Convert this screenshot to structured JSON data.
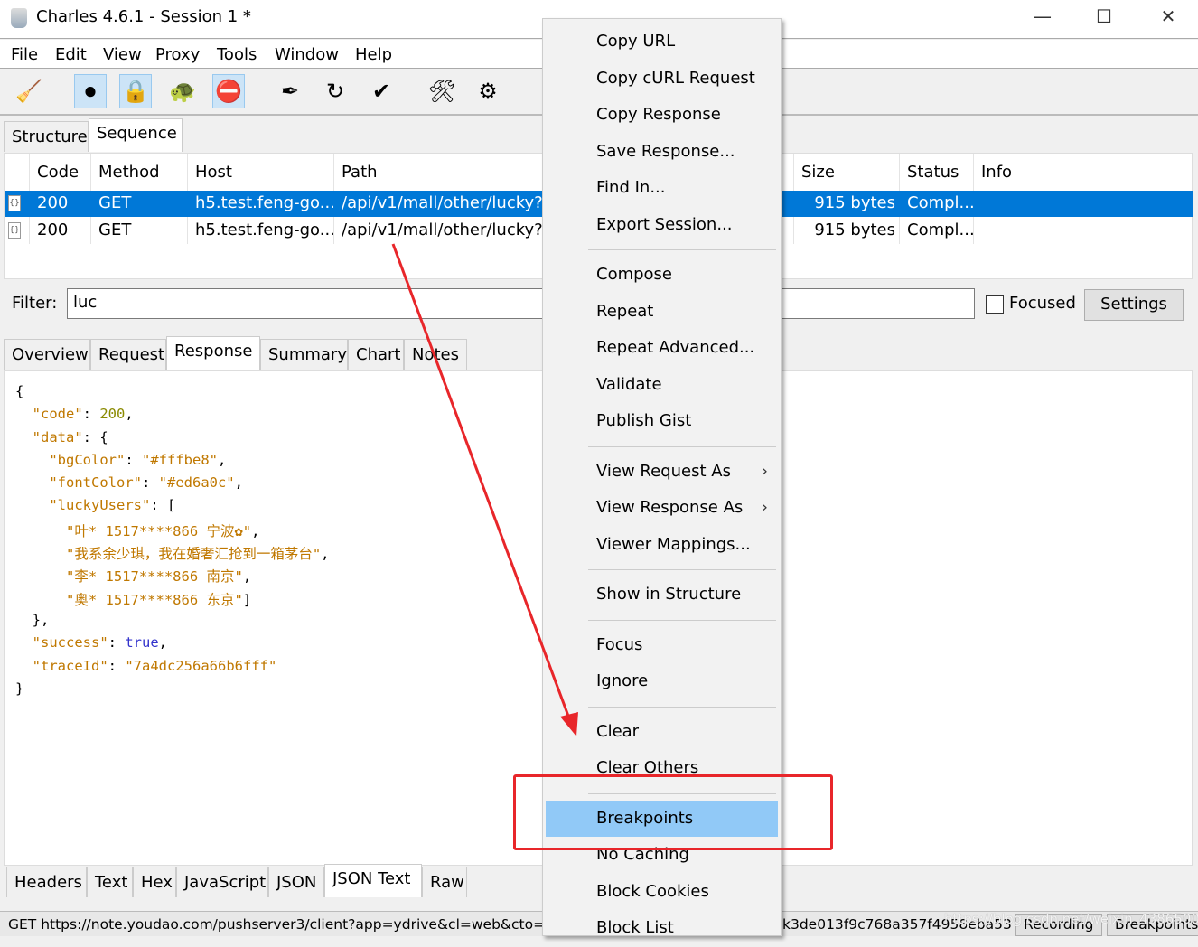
{
  "window": {
    "title": "Charles 4.6.1 - Session 1 *",
    "minimize": "—",
    "maximize": "☐",
    "close": "✕"
  },
  "menubar": [
    "File",
    "Edit",
    "View",
    "Proxy",
    "Tools",
    "Window",
    "Help"
  ],
  "toolbar": [
    {
      "icon": "broom-icon",
      "glyph": "🧹",
      "active": false
    },
    {
      "icon": "record-icon",
      "glyph": "⏺",
      "active": true
    },
    {
      "icon": "ssl-proxying-lock-icon",
      "glyph": "🔒",
      "active": true
    },
    {
      "icon": "throttle-turtle-icon",
      "glyph": "🐢",
      "active": false
    },
    {
      "icon": "breakpoints-stop-icon",
      "glyph": "⛔",
      "active": true
    },
    {
      "icon": "compose-pen-icon",
      "glyph": "✒",
      "active": false
    },
    {
      "icon": "repeat-icon",
      "glyph": "↻",
      "active": false
    },
    {
      "icon": "validate-check-icon",
      "glyph": "✔",
      "active": false
    },
    {
      "icon": "tools-icon",
      "glyph": "🛠",
      "active": false
    },
    {
      "icon": "settings-gear-icon",
      "glyph": "⚙",
      "active": false
    }
  ],
  "view_tabs": [
    {
      "label": "Structure",
      "active": false
    },
    {
      "label": "Sequence",
      "active": true
    }
  ],
  "table": {
    "columns": [
      "Code",
      "Method",
      "Host",
      "Path",
      "Size",
      "Status",
      "Info"
    ],
    "rows": [
      {
        "code": "200",
        "method": "GET",
        "host": "h5.test.feng-go....",
        "path": "/api/v1/mall/other/lucky?",
        "size": "915 bytes",
        "status": "Compl...",
        "info": "",
        "selected": true
      },
      {
        "code": "200",
        "method": "GET",
        "host": "h5.test.feng-go....",
        "path": "/api/v1/mall/other/lucky?",
        "size": "915 bytes",
        "status": "Compl...",
        "info": "",
        "selected": false
      }
    ]
  },
  "filter": {
    "label": "Filter:",
    "value": "luc",
    "focused_label": "Focused",
    "focused_checked": false,
    "settings_label": "Settings"
  },
  "detail_tabs": [
    {
      "label": "Overview"
    },
    {
      "label": "Request"
    },
    {
      "label": "Response",
      "active": true
    },
    {
      "label": "Summary"
    },
    {
      "label": "Chart"
    },
    {
      "label": "Notes"
    }
  ],
  "json_lines": [
    [
      [
        "p",
        "{"
      ]
    ],
    [
      [
        "p",
        "  "
      ],
      [
        "k",
        "\"code\""
      ],
      [
        "p",
        ": "
      ],
      [
        "n",
        "200"
      ],
      [
        "p",
        ","
      ]
    ],
    [
      [
        "p",
        "  "
      ],
      [
        "k",
        "\"data\""
      ],
      [
        "p",
        ": {"
      ]
    ],
    [
      [
        "p",
        "    "
      ],
      [
        "k",
        "\"bgColor\""
      ],
      [
        "p",
        ": "
      ],
      [
        "s",
        "\"#fffbe8\""
      ],
      [
        "p",
        ","
      ]
    ],
    [
      [
        "p",
        "    "
      ],
      [
        "k",
        "\"fontColor\""
      ],
      [
        "p",
        ": "
      ],
      [
        "s",
        "\"#ed6a0c\""
      ],
      [
        "p",
        ","
      ]
    ],
    [
      [
        "p",
        "    "
      ],
      [
        "k",
        "\"luckyUsers\""
      ],
      [
        "p",
        ": ["
      ]
    ],
    [
      [
        "p",
        "      "
      ],
      [
        "s",
        "\"叶* 1517****866 宁波✿\""
      ],
      [
        "p",
        ","
      ]
    ],
    [
      [
        "p",
        "      "
      ],
      [
        "s",
        "\"我系余少琪，我在婚奢汇抢到一箱茅台\""
      ],
      [
        "p",
        ","
      ]
    ],
    [
      [
        "p",
        "      "
      ],
      [
        "s",
        "\"李* 1517****866 南京\""
      ],
      [
        "p",
        ","
      ]
    ],
    [
      [
        "p",
        "      "
      ],
      [
        "s",
        "\"奥* 1517****866 东京\""
      ],
      [
        "p",
        "]"
      ]
    ],
    [
      [
        "p",
        "  },"
      ]
    ],
    [
      [
        "p",
        "  "
      ],
      [
        "k",
        "\"success\""
      ],
      [
        "p",
        ": "
      ],
      [
        "b",
        "true"
      ],
      [
        "p",
        ","
      ]
    ],
    [
      [
        "p",
        "  "
      ],
      [
        "k",
        "\"traceId\""
      ],
      [
        "p",
        ": "
      ],
      [
        "s",
        "\"7a4dc256a66b6fff\""
      ]
    ],
    [
      [
        "p",
        "}"
      ]
    ]
  ],
  "format_tabs": [
    {
      "label": "Headers"
    },
    {
      "label": "Text"
    },
    {
      "label": "Hex"
    },
    {
      "label": "JavaScript"
    },
    {
      "label": "JSON"
    },
    {
      "label": "JSON Text",
      "active": true
    },
    {
      "label": "Raw"
    }
  ],
  "statusbar": {
    "left_text": "GET https://note.youdao.com/pushserver3/client?app=ydrive&cl=web&cto=600(",
    "right_text": "k3de013f9c768a357f4958eba53",
    "recording_label": "Recording",
    "breakpoints_label": "Breakpoints",
    "watermark": "https://blog.csdn.net/weixin_43865008"
  },
  "context_menu": [
    {
      "label": "Copy URL"
    },
    {
      "label": "Copy cURL Request"
    },
    {
      "label": "Copy Response"
    },
    {
      "label": "Save Response..."
    },
    {
      "label": "Find In..."
    },
    {
      "label": "Export Session..."
    },
    {
      "sep": true
    },
    {
      "label": "Compose"
    },
    {
      "label": "Repeat"
    },
    {
      "label": "Repeat Advanced..."
    },
    {
      "label": "Validate"
    },
    {
      "label": "Publish Gist"
    },
    {
      "sep": true
    },
    {
      "label": "View Request As",
      "submenu": true
    },
    {
      "label": "View Response As",
      "submenu": true
    },
    {
      "label": "Viewer Mappings..."
    },
    {
      "sep": true
    },
    {
      "label": "Show in Structure"
    },
    {
      "sep": true
    },
    {
      "label": "Focus"
    },
    {
      "label": "Ignore"
    },
    {
      "sep": true
    },
    {
      "label": "Clear"
    },
    {
      "label": "Clear Others"
    },
    {
      "sep": true
    },
    {
      "label": "Breakpoints",
      "highlighted": true
    },
    {
      "label": "No Caching"
    },
    {
      "label": "Block Cookies"
    },
    {
      "label": "Block List"
    }
  ],
  "annotation_color": "#e8262a",
  "selection_color": "#0078d7"
}
